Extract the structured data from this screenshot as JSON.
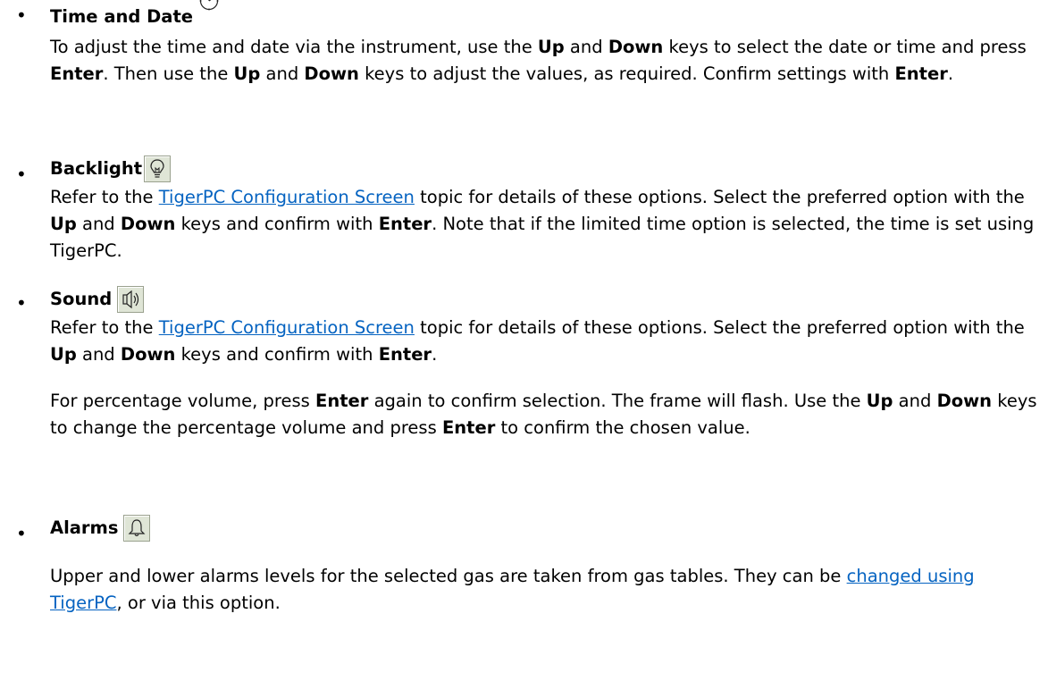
{
  "bullet_glyph": "•",
  "time_date": {
    "title": "Time and Date",
    "icon": "clock-icon",
    "para": {
      "t1": "To adjust the time and date via the instrument, use the ",
      "b1": "Up",
      "t2": " and ",
      "b2": "Down",
      "t3": " keys to select the date or time and press ",
      "b3": "Enter",
      "t4": ". Then use the ",
      "b4": "Up",
      "t5": " and ",
      "b5": "Down",
      "t6": " keys to adjust the values, as required. Confirm settings with ",
      "b6": "Enter",
      "t7": "."
    }
  },
  "backlight": {
    "title": "Backlight",
    "icon": "lightbulb-icon",
    "para": {
      "t1": "Refer to the ",
      "link": "TigerPC Configuration Screen",
      "t2": " topic for details of these options. Select the preferred option with the ",
      "b1": "Up",
      "t3": " and ",
      "b2": "Down",
      "t4": " keys and confirm with ",
      "b3": "Enter",
      "t5": ". Note that if the limited time option is selected, the time is set using TigerPC."
    }
  },
  "sound": {
    "title": "Sound",
    "icon": "speaker-icon",
    "para1": {
      "t1": "Refer to the ",
      "link": "TigerPC Configuration Screen",
      "t2": " topic for details of these options. Select the preferred option with the ",
      "b1": "Up",
      "t3": " and ",
      "b2": "Down",
      "t4": " keys and confirm with ",
      "b3": "Enter",
      "t5": "."
    },
    "para2": {
      "t1": "For percentage volume, press ",
      "b1": "Enter",
      "t2": " again to confirm selection. The frame will flash. Use the ",
      "b2": "Up",
      "t3": " and ",
      "b3": "Down",
      "t4": " keys to change the percentage volume and press ",
      "b4": "Enter",
      "t5": " to confirm the chosen value."
    }
  },
  "alarms": {
    "title": "Alarms",
    "icon": "bell-icon",
    "para": {
      "t1": "Upper and lower alarms levels for the selected gas are taken from gas tables. They can be ",
      "link": "changed using TigerPC",
      "t2": ", or via this option."
    }
  },
  "colors": {
    "link": "#0563c1",
    "icon_bg": "#dfe5d6"
  }
}
